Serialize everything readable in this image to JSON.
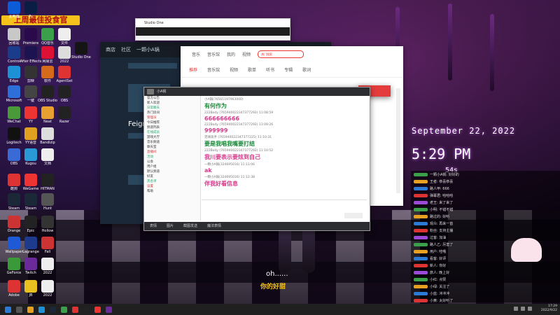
{
  "banner": "上周最佳投食官",
  "clock": {
    "date": "September 22, 2022",
    "time": "5:29 PM",
    "seconds": "54s"
  },
  "subtitle": "oh......",
  "subtitle2": "你的好甜",
  "steam": {
    "tabs": [
      "商店",
      "社区",
      "一颗小A锅"
    ],
    "game_title": "Feign"
  },
  "yy": {
    "room": "小A锅",
    "messages": [
      {
        "meta": "小A锅(76561197963000)",
        "body": "有何作为",
        "color": "#1a8a3a"
      },
      {
        "meta": "222Body (765940022347377292) 11:08:59",
        "body": "666666666",
        "color": "#d43b8a"
      },
      {
        "meta": "222Body (765940022347377292) 11:09:26",
        "body": "999999",
        "color": "#d43b8a"
      },
      {
        "meta": "足球高手 (765940022347377225) 11:10:31",
        "body": "要是我唱我嘴要打结",
        "color": "#1a8a3a"
      },
      {
        "meta": "222Body (765940022347377292) 11:10:52",
        "body": "我川要表示要炫到自己",
        "color": "#d43b8a"
      },
      {
        "meta": "一颗小A锅(324695016) 11:11:06",
        "body": "ak",
        "color": "#d43b8a"
      },
      {
        "meta": "一颗小A锅(324695016) 11:12:38",
        "body": "伴我好看信息",
        "color": "#d43b8a"
      }
    ],
    "side_rows": [
      "官方公告",
      "新人欢迎",
      "日常聊天",
      "热门房间",
      "管理员",
      "今日推荐",
      "频道列表",
      "在线成员",
      "游戏大厅",
      "音乐频道",
      "聊天室",
      "直播间",
      "活动",
      "公会",
      "用户组",
      "默认频道",
      "好友",
      "黑名单",
      "设置",
      "帮助"
    ],
    "footer": [
      "表情",
      "图片",
      "截图发送",
      "魔法表情",
      "发送"
    ]
  },
  "music": {
    "nav": [
      "推荐",
      "音乐馆",
      "视频",
      "歌单",
      "听书",
      "专辑",
      "歌词"
    ],
    "top": [
      "音乐",
      "音乐馆",
      "我的",
      "视频"
    ],
    "search": "热门搜索"
  },
  "overlay_lines": [
    "一颗小A锅: 好好的",
    "王者: 恭喜恭喜",
    "路人甲: 666",
    "弹幕君: 哈哈哈",
    "老王: 来了来了",
    "小明: 不错不错",
    "路过的: 好听",
    "观众: 再来一首",
    "粉丝: 支持主播",
    "过客: 加油",
    "路人乙: 厉害了",
    "用户: 哇哦",
    "看客: 好评",
    "新人: 你好",
    "旅人: 晚上好",
    "小红: 点赞",
    "小绿: 关注了",
    "小蓝: 冲冲冲",
    "小黄: 太好听了"
  ],
  "tray": {
    "time": "17:29",
    "date": "2022/9/22"
  }
}
